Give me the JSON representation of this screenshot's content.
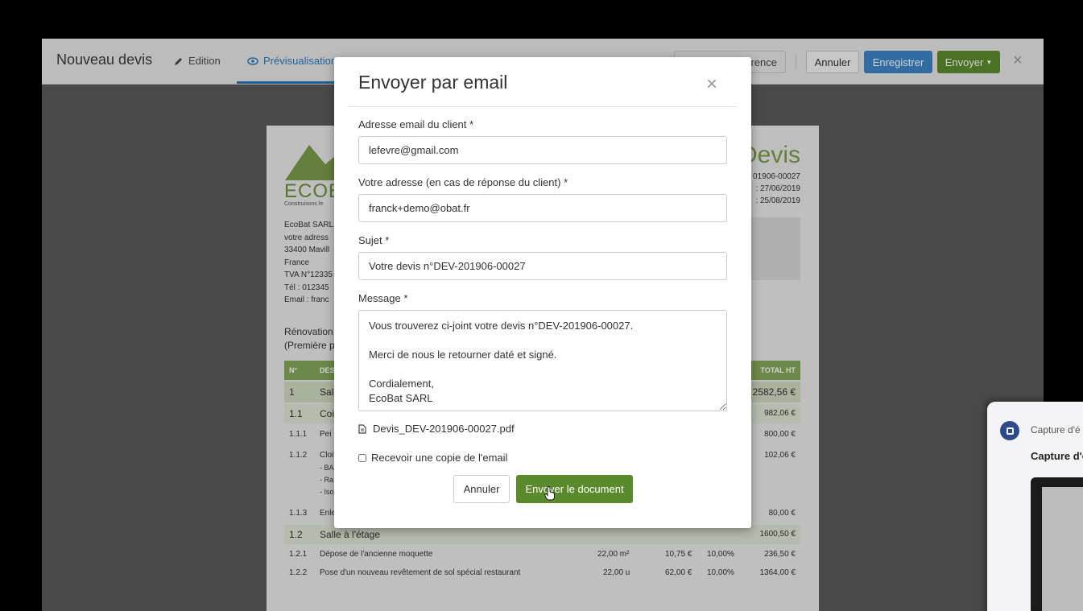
{
  "app": {
    "title": "Nouveau devis",
    "tabs": [
      {
        "label": "Edition",
        "icon": "pencil-icon"
      },
      {
        "label": "Prévisualisation",
        "icon": "eye-icon"
      }
    ],
    "toolbar": {
      "reference_partial": "rence",
      "cancel_label": "Annuler",
      "save_label": "Enregistrer",
      "send_label": "Envoyer",
      "close_symbol": "×"
    }
  },
  "document": {
    "logo_text": "ECOBA",
    "logo_tagline": "Construisons le",
    "sender_lines": [
      "EcoBat SARL",
      "votre adress",
      "33400 Mavill",
      "France",
      "TVA N°12335",
      "Tél : 012345",
      "Email : franc"
    ],
    "title": "Devis",
    "meta_lines": [
      "01906-00027",
      ": 27/06/2019",
      ": 25/08/2019"
    ],
    "renovation_lines": [
      "Rénovation",
      "(Première p"
    ],
    "table_headers": {
      "num": "N°",
      "desc": "DES",
      "total": "TOTAL HT"
    },
    "rows": [
      {
        "num": "1",
        "desc": "Sal",
        "qty": "",
        "price": "",
        "vat": "",
        "total": "2582,56 €",
        "kind": "section"
      },
      {
        "num": "1.1",
        "desc": "Coi",
        "qty": "",
        "price": "",
        "vat": "",
        "total": "982,06 €",
        "kind": "sub"
      },
      {
        "num": "1.1.1",
        "desc": "Pei",
        "qty": "",
        "price": "",
        "vat": "",
        "total": "800,00 €",
        "kind": "item"
      },
      {
        "num": "1.1.2",
        "desc": "Cloi",
        "qty": "",
        "price": "",
        "vat": "",
        "total": "102,06 €",
        "kind": "item"
      },
      {
        "num": "1.1.3",
        "desc": "Enle",
        "qty": "",
        "price": "",
        "vat": "",
        "total": "80,00 €",
        "kind": "item"
      },
      {
        "num": "1.2",
        "desc": "Salle à l'étage",
        "qty": "",
        "price": "",
        "vat": "",
        "total": "1600,50 €",
        "kind": "sub"
      },
      {
        "num": "1.2.1",
        "desc": "Dépose de l'ancienne moquette",
        "qty": "22,00 m²",
        "price": "10,75 €",
        "vat": "10,00%",
        "total": "236,50 €",
        "kind": "item"
      },
      {
        "num": "1.2.2",
        "desc": "Pose d'un nouveau revêtement de sol spécial restaurant",
        "qty": "22,00 u",
        "price": "62,00 €",
        "vat": "10,00%",
        "total": "1364,00 €",
        "kind": "item"
      }
    ],
    "sub_bullets": [
      "- BA",
      "- Ra",
      "- Iso"
    ]
  },
  "modal": {
    "title": "Envoyer par email",
    "close_symbol": "×",
    "client_email_label": "Adresse email du client *",
    "client_email_value": "lefevre@gmail.com",
    "reply_label": "Votre adresse (en cas de réponse du client) *",
    "reply_value": "franck+demo@obat.fr",
    "subject_label": "Sujet *",
    "subject_value": "Votre devis n°DEV-201906-00027",
    "message_label": "Message *",
    "message_value": "Vous trouverez ci-joint votre devis n°DEV-201906-00027.\n\nMerci de nous le retourner daté et signé.\n\nCordialement,\nEcoBat SARL",
    "attachment": "Devis_DEV-201906-00027.pdf",
    "copy_label": "Recevoir une copie de l'email",
    "copy_checked": false,
    "cancel_label": "Annuler",
    "send_label": "Envoyer le document"
  },
  "capture_popup": {
    "line1": "Capture d'é",
    "line2": "Capture d'é"
  },
  "colors": {
    "primary_blue": "#3d84c6",
    "accent_green": "#5b8a2c",
    "tab_active": "#2a7ab8"
  }
}
